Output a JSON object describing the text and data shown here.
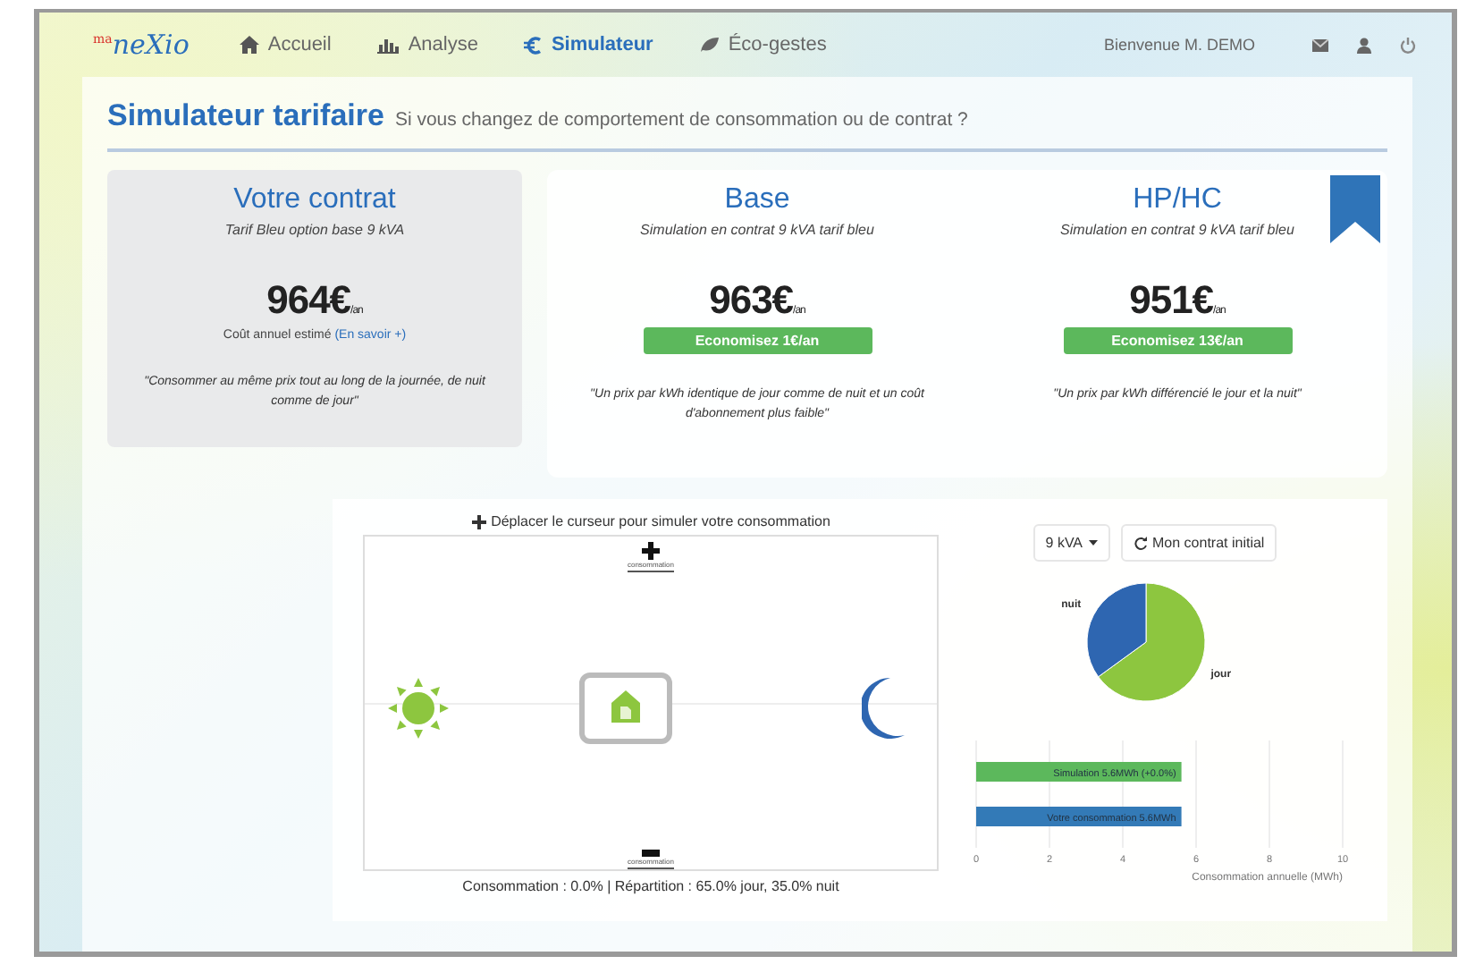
{
  "nav": {
    "brand_prefix": "ma",
    "brand": "neXio",
    "items": [
      {
        "label": "Accueil",
        "selected": false
      },
      {
        "label": "Analyse",
        "selected": false
      },
      {
        "label": "Simulateur",
        "selected": true
      },
      {
        "label": "Éco-gestes",
        "selected": false
      }
    ],
    "greeting": "Bienvenue M. DEMO"
  },
  "header": {
    "title": "Simulateur tarifaire",
    "subtitle": "Si vous changez de comportement de consommation ou de contrat ?"
  },
  "cards": [
    {
      "kind": "current",
      "title": "Votre contrat",
      "subtitle": "Tarif Bleu option base 9 kVA",
      "price": "964€",
      "unit": "/an",
      "note": "Coût annuel estimé",
      "link": "(En savoir +)",
      "quote": "\"Consommer au même prix tout au long de la journée, de nuit comme de jour\""
    },
    {
      "kind": "simulation",
      "title": "Base",
      "subtitle": "Simulation en contrat 9 kVA tarif bleu",
      "price": "963€",
      "unit": "/an",
      "savings": "Economisez 1€/an",
      "quote": "\"Un prix par kWh identique de jour comme de nuit et un coût d'abonnement plus faible\"",
      "bookmarked": false
    },
    {
      "kind": "simulation",
      "title": "HP/HC",
      "subtitle": "Simulation en contrat 9 kVA tarif bleu",
      "price": "951€",
      "unit": "/an",
      "savings": "Economisez 13€/an",
      "quote": "\"Un prix par kWh différencié le jour et la nuit\"",
      "bookmarked": true
    }
  ],
  "simulator": {
    "hint": "Déplacer le curseur pour simuler votre consommation",
    "top_label": "consommation",
    "bottom_label": "consommation",
    "status": "Consommation : 0.0% | Répartition : 65.0% jour, 35.0% nuit",
    "power_select": "9 kVA",
    "reset_button": "Mon contrat initial",
    "pie": {
      "chart_data": {
        "type": "pie",
        "categories": [
          "jour",
          "nuit"
        ],
        "values": [
          65,
          35
        ]
      }
    },
    "bars": {
      "chart_data": {
        "type": "bar",
        "orientation": "horizontal",
        "stacked": true,
        "categories": [
          "Simulation 5.6MWh (+0.0%)",
          "Votre consommation 5.6MWh"
        ],
        "xlabel": "Consommation annuelle (MWh)",
        "xlim": [
          0,
          10
        ],
        "xticks": [
          0,
          2,
          4,
          6,
          8,
          10
        ],
        "grid": true,
        "series": [
          {
            "color": "#5cb85c",
            "values": [
              5.6,
              null
            ]
          },
          {
            "color": "#337ab7",
            "values": [
              null,
              5.6
            ]
          }
        ]
      }
    }
  }
}
